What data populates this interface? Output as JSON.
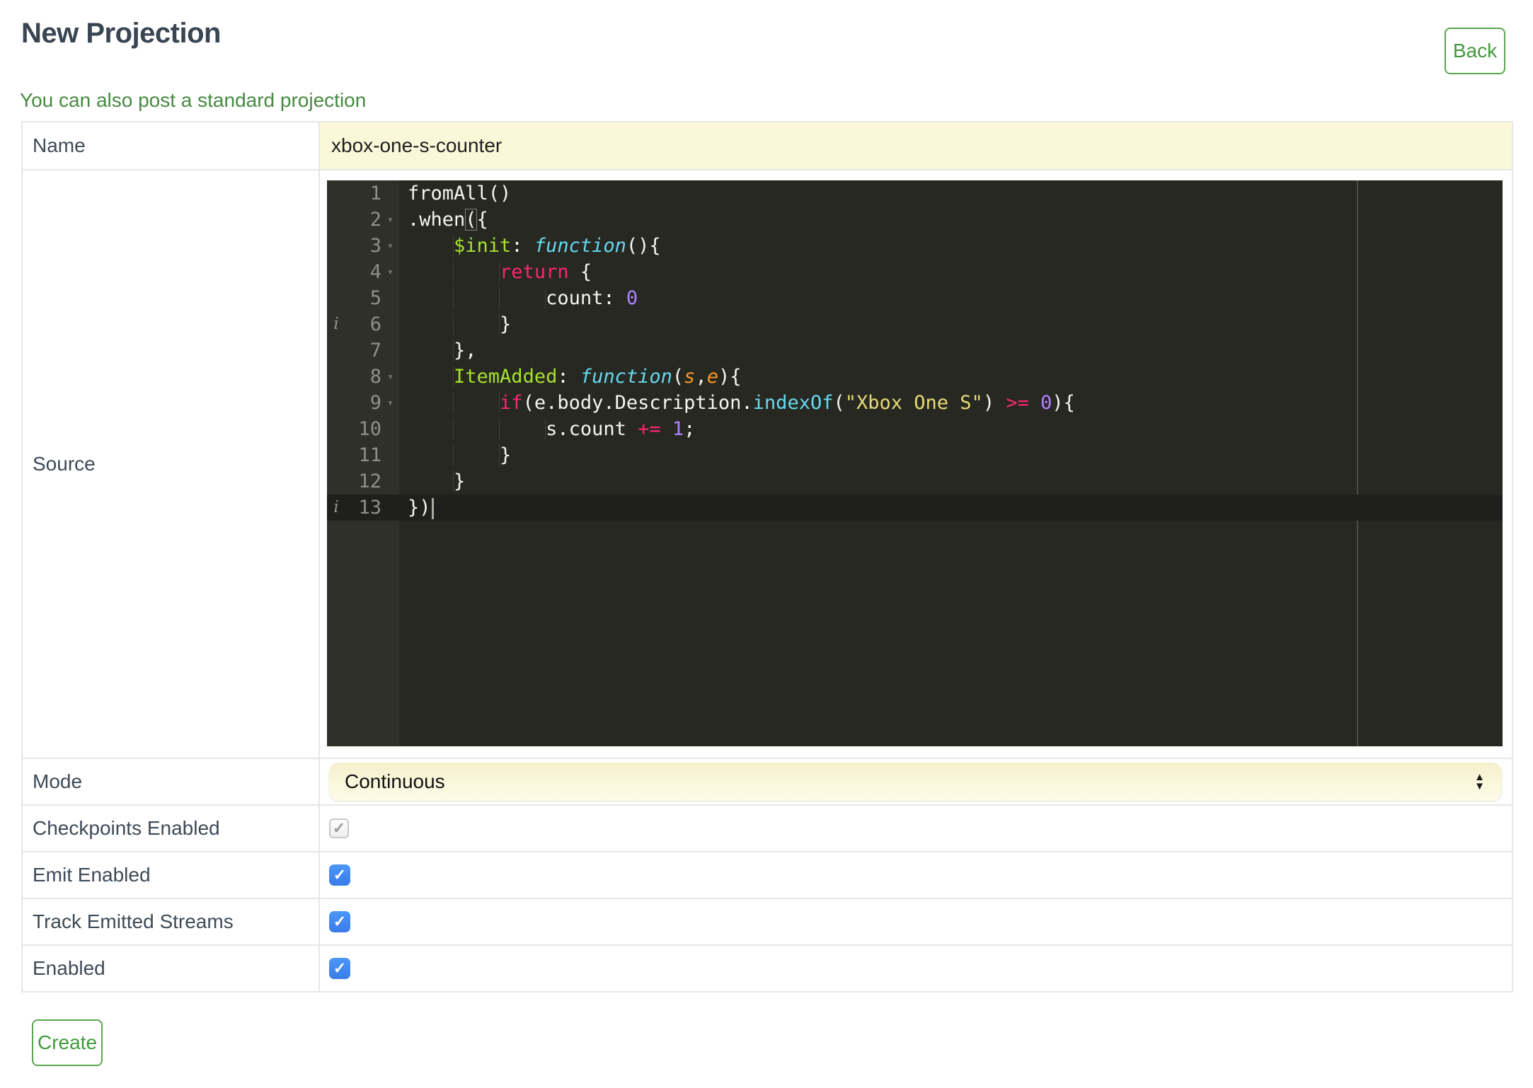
{
  "header": {
    "title": "New Projection",
    "back_label": "Back"
  },
  "subheader": {
    "link_text": "You can also post a standard projection"
  },
  "form": {
    "labels": {
      "name": "Name",
      "source": "Source",
      "mode": "Mode",
      "checkpoints": "Checkpoints Enabled",
      "emit": "Emit Enabled",
      "track": "Track Emitted Streams",
      "enabled": "Enabled"
    },
    "name_value": "xbox-one-s-counter",
    "mode_value": "Continuous",
    "checkboxes": {
      "checkpoints": {
        "checked": true,
        "disabled": true
      },
      "emit": {
        "checked": true,
        "disabled": false
      },
      "track": {
        "checked": true,
        "disabled": false
      },
      "enabled": {
        "checked": true,
        "disabled": false
      }
    }
  },
  "footer": {
    "create_label": "Create"
  },
  "icons": {
    "check": "✓",
    "select_arrow_up": "▲",
    "select_arrow_down": "▼",
    "fold": "▾",
    "info": "i"
  },
  "colors": {
    "accent_green": "#419A3A",
    "link_green": "#478A41",
    "autofill_yellow": "#FBF8D9",
    "checkbox_blue": "#3F89F0",
    "title_slate": "#3A4553",
    "editor_bg": "#272822",
    "editor_gutter_bg": "#2F302A",
    "editor_active_line": "#1F1F1E",
    "editor_line_number": "#8F908A",
    "code_text": "#F6F6F0",
    "code_keyword_pink": "#F92672",
    "code_function_green": "#A6E22E",
    "code_cyan": "#66D9EF",
    "code_string_yellow": "#E6DB74",
    "code_number_purple": "#AE81FF",
    "code_param_orange": "#FD971F"
  },
  "editor": {
    "lines": [
      {
        "n": 1,
        "tokens": [
          [
            "t",
            "fromAll()"
          ]
        ]
      },
      {
        "n": 2,
        "fold": true,
        "tokens": [
          [
            "t",
            ".when"
          ],
          [
            "b",
            "("
          ],
          [
            "t",
            "{"
          ]
        ]
      },
      {
        "n": 3,
        "fold": true,
        "tokens": [
          [
            "i",
            "    "
          ],
          [
            "g",
            "$init"
          ],
          [
            "t",
            ": "
          ],
          [
            "f",
            "function"
          ],
          [
            "t",
            "(){"
          ]
        ]
      },
      {
        "n": 4,
        "fold": true,
        "tokens": [
          [
            "i",
            "        "
          ],
          [
            "k",
            "return"
          ],
          [
            "t",
            " {"
          ]
        ]
      },
      {
        "n": 5,
        "tokens": [
          [
            "i",
            "            "
          ],
          [
            "t",
            "count: "
          ],
          [
            "p",
            "0"
          ]
        ]
      },
      {
        "n": 6,
        "info": true,
        "tokens": [
          [
            "i",
            "        "
          ],
          [
            "t",
            "}"
          ]
        ]
      },
      {
        "n": 7,
        "tokens": [
          [
            "i",
            "    "
          ],
          [
            "t",
            "},"
          ]
        ]
      },
      {
        "n": 8,
        "fold": true,
        "tokens": [
          [
            "i",
            "    "
          ],
          [
            "g",
            "ItemAdded"
          ],
          [
            "t",
            ": "
          ],
          [
            "f",
            "function"
          ],
          [
            "t",
            "("
          ],
          [
            "o",
            "s"
          ],
          [
            "t",
            ","
          ],
          [
            "o",
            "e"
          ],
          [
            "t",
            "){"
          ]
        ]
      },
      {
        "n": 9,
        "fold": true,
        "tokens": [
          [
            "i",
            "        "
          ],
          [
            "k",
            "if"
          ],
          [
            "t",
            "(e.body.Description."
          ],
          [
            "s",
            "indexOf"
          ],
          [
            "t",
            "("
          ],
          [
            "y",
            "\"Xbox One S\""
          ],
          [
            "t",
            ") "
          ],
          [
            "k",
            ">="
          ],
          [
            "t",
            " "
          ],
          [
            "p",
            "0"
          ],
          [
            "t",
            "){"
          ]
        ]
      },
      {
        "n": 10,
        "tokens": [
          [
            "i",
            "            "
          ],
          [
            "t",
            "s.count "
          ],
          [
            "k",
            "+="
          ],
          [
            "t",
            " "
          ],
          [
            "p",
            "1"
          ],
          [
            "t",
            ";"
          ]
        ]
      },
      {
        "n": 11,
        "tokens": [
          [
            "i",
            "        "
          ],
          [
            "t",
            "}"
          ]
        ]
      },
      {
        "n": 12,
        "tokens": [
          [
            "i",
            "    "
          ],
          [
            "t",
            "}"
          ]
        ]
      },
      {
        "n": 13,
        "info": true,
        "active": true,
        "cursor": true,
        "tokens": [
          [
            "t",
            "})"
          ]
        ]
      }
    ]
  }
}
